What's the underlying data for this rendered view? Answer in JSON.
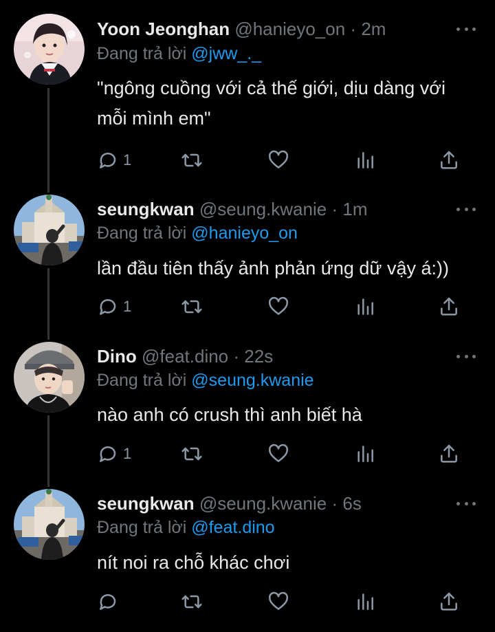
{
  "tweets": [
    {
      "name": "Yoon Jeonghan",
      "handle": "@hanieyo_on",
      "separator": "·",
      "time": "2m",
      "reply_prefix": "Đang trả lời",
      "reply_to": "@jww_._",
      "text": "\"ngông cuồng với cả thế giới, dịu dàng với mỗi mình em\"",
      "reply_count": "1",
      "avatar_desc": "girl-portrait"
    },
    {
      "name": "seungkwan",
      "handle": "@seung.kwanie",
      "separator": "·",
      "time": "1m",
      "reply_prefix": "Đang trả lời",
      "reply_to": "@hanieyo_on",
      "text": "lần đầu tiên thấy ảnh phản ứng dữ vậy á:))",
      "reply_count": "1",
      "avatar_desc": "city-church"
    },
    {
      "name": "Dino",
      "handle": "@feat.dino",
      "separator": "·",
      "time": "22s",
      "reply_prefix": "Đang trả lời",
      "reply_to": "@seung.kwanie",
      "text": "nào anh có crush thì anh biết hà",
      "reply_count": "1",
      "avatar_desc": "boy-cap"
    },
    {
      "name": "seungkwan",
      "handle": "@seung.kwanie",
      "separator": "·",
      "time": "6s",
      "reply_prefix": "Đang trả lời",
      "reply_to": "@feat.dino",
      "text": "nít noi ra chỗ khác chơi",
      "reply_count": "",
      "avatar_desc": "city-church"
    }
  ],
  "icons": {
    "reply": "comment-icon",
    "retweet": "retweet-icon",
    "like": "heart-icon",
    "views": "views-chart-icon",
    "share": "share-icon",
    "more": "more-dots-icon"
  },
  "colors": {
    "background": "#000000",
    "text": "#e7e9ea",
    "secondary": "#71767b",
    "link": "#1d9bf0",
    "thread_line": "#333639"
  }
}
